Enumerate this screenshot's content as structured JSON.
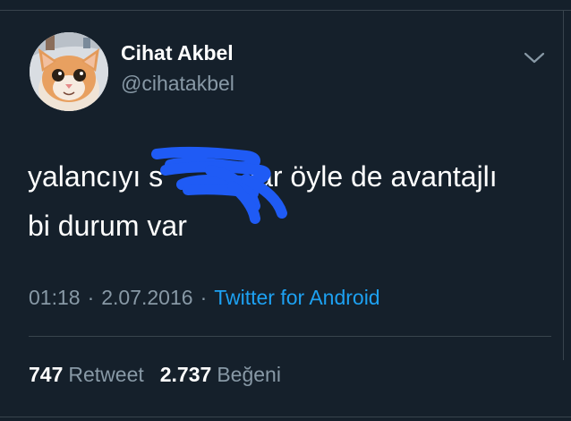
{
  "tweet": {
    "display_name": "Cihat Akbel",
    "handle": "@cihatakbel",
    "text_line1": "yalancıyı s",
    "text_line1_rest": "ıar öyle de avantajlı",
    "text_line2": "bi durum var",
    "time": "01:18",
    "date": "2.07.2016",
    "separator": "·",
    "source": "Twitter for Android",
    "retweet_count": "747",
    "retweet_label": "Retweet",
    "like_count": "2.737",
    "like_label": "Beğeni"
  },
  "icons": {
    "menu": "chevron-down-icon",
    "avatar": "cat-avatar",
    "redaction": "blue-scribble"
  },
  "colors": {
    "background": "#15202b",
    "secondary_text": "#8899a6",
    "link": "#1da1f2",
    "scribble": "#1f5bf5"
  }
}
